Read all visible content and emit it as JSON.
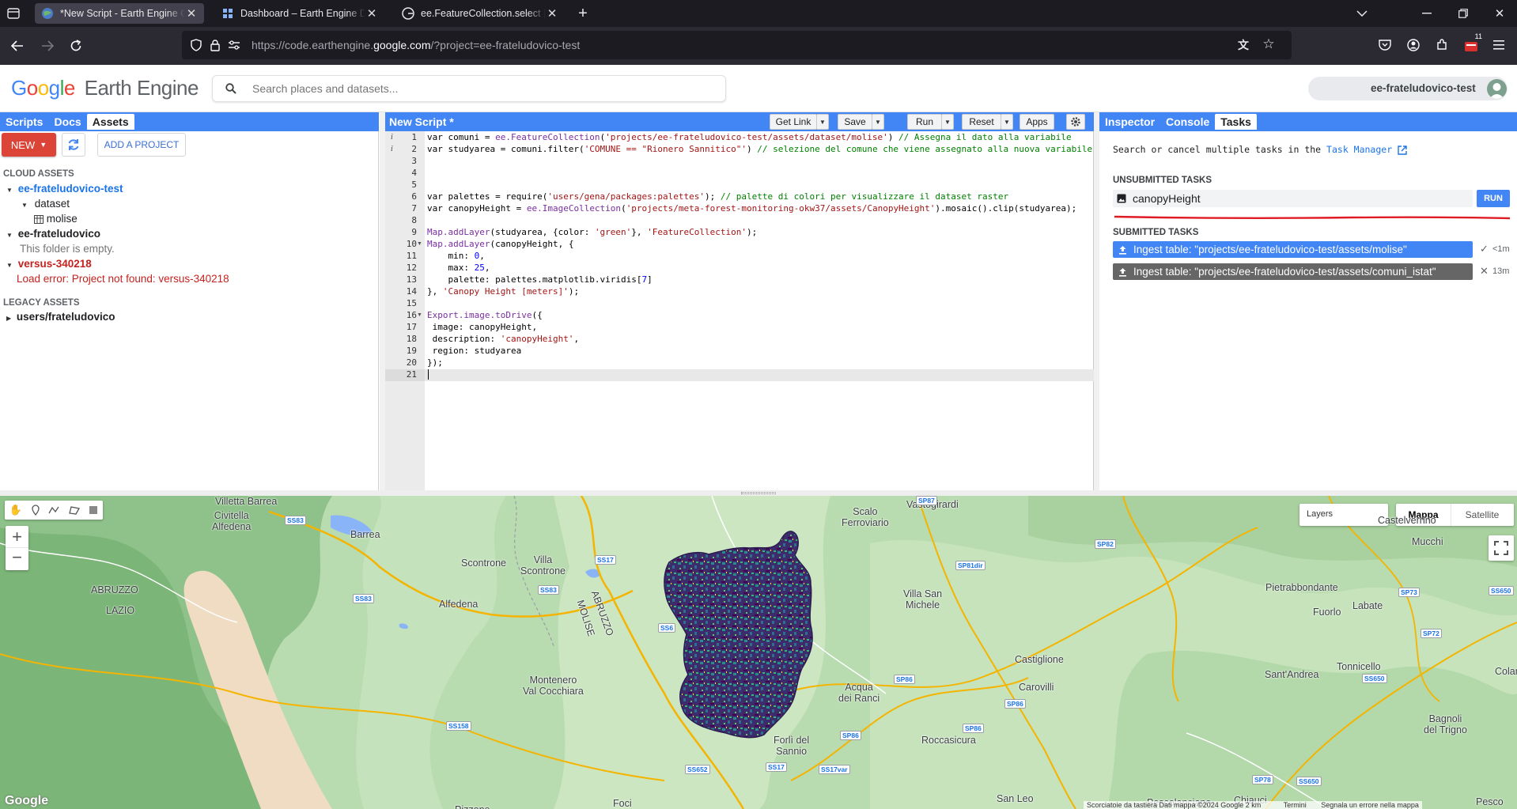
{
  "browser": {
    "tabs": [
      {
        "title": "*New Script - Earth Engine Code Editor"
      },
      {
        "title": "Dashboard – Earth Engine Default"
      },
      {
        "title": "ee.FeatureCollection.select | Google"
      }
    ],
    "url_prefix": "https://code.earthengine.",
    "url_domain": "google.com",
    "url_suffix": "/?project=ee-frateludovico-test",
    "extension_badge": "11"
  },
  "header": {
    "logo_letters": [
      "G",
      "o",
      "o",
      "g",
      "l",
      "e"
    ],
    "logo_colors": [
      "#4285f4",
      "#ea4335",
      "#fbbc05",
      "#4285f4",
      "#34a853",
      "#ea4335"
    ],
    "product": "Earth Engine",
    "search_placeholder": "Search places and datasets...",
    "account": "ee-frateludovico-test"
  },
  "left_panel": {
    "tabs": [
      "Scripts",
      "Docs",
      "Assets"
    ],
    "new_label": "NEW",
    "add_project": "ADD A PROJECT",
    "cloud_assets": "CLOUD ASSETS",
    "legacy_assets": "LEGACY ASSETS",
    "tree": {
      "p1": "ee-frateludovico-test",
      "folder": "dataset",
      "table": "molise",
      "p2": "ee-frateludovico",
      "empty": "This folder is empty.",
      "p3": "versus-340218",
      "error": "Load error: Project not found: versus-340218",
      "legacy": "users/frateludovico"
    }
  },
  "editor": {
    "title": "New Script *",
    "buttons": {
      "get_link": "Get Link",
      "save": "Save",
      "run": "Run",
      "reset": "Reset",
      "apps": "Apps"
    },
    "line_numbers": [
      "1",
      "2",
      "3",
      "4",
      "5",
      "6",
      "7",
      "8",
      "9",
      "10",
      "11",
      "12",
      "13",
      "14",
      "15",
      "16",
      "17",
      "18",
      "19",
      "20",
      "21"
    ],
    "code": {
      "l1a": "var comuni = ",
      "l1b": "ee.FeatureCollection",
      "l1c": "(",
      "l1d": "'projects/ee-frateludovico-test/assets/dataset/molise'",
      "l1e": ") ",
      "l1f": "// Assegna il dato alla variabile",
      "l2a": "var studyarea = comuni.filter(",
      "l2b": "'COMUNE == \"Rionero Sannitico\"'",
      "l2c": ") ",
      "l2d": "// selezione del comune che viene assegnato alla nuova variabile",
      "l6a": "var palettes = require(",
      "l6b": "'users/gena/packages:palettes'",
      "l6c": "); ",
      "l6d": "// palette di colori per visualizzare il dataset raster",
      "l7a": "var canopyHeight = ",
      "l7b": "ee.ImageCollection",
      "l7c": "(",
      "l7d": "'projects/meta-forest-monitoring-okw37/assets/CanopyHeight'",
      "l7e": ").mosaic().clip(studyarea);",
      "l9a": "Map.addLayer",
      "l9b": "(studyarea, {color: ",
      "l9c": "'green'",
      "l9d": "}, ",
      "l9e": "'FeatureCollection'",
      "l9f": ");",
      "l10a": "Map.addLayer",
      "l10b": "(canopyHeight, {",
      "l11a": "    min: ",
      "l11b": "0",
      "l11c": ",",
      "l12a": "    max: ",
      "l12b": "25",
      "l12c": ",",
      "l13a": "    palette: palettes.matplotlib.viridis[",
      "l13b": "7",
      "l13c": "]",
      "l14a": "}, ",
      "l14b": "'Canopy Height [meters]'",
      "l14c": ");",
      "l16a": "Export.image.toDrive",
      "l16b": "({",
      "l17": " image: canopyHeight,",
      "l18a": " description: ",
      "l18b": "'canopyHeight'",
      "l18c": ",",
      "l19": " region: studyarea",
      "l20": "});"
    }
  },
  "right_panel": {
    "tabs": [
      "Inspector",
      "Console",
      "Tasks"
    ],
    "intro": "Search or cancel multiple tasks in the",
    "task_manager": "Task Manager",
    "unsubmitted_header": "UNSUBMITTED TASKS",
    "unsubmitted_task": "canopyHeight",
    "run_label": "RUN",
    "submitted_header": "SUBMITTED TASKS",
    "submitted": [
      {
        "label": "Ingest table: \"projects/ee-frateludovico-test/assets/molise\"",
        "status": "✓",
        "time": "<1m",
        "color": "#4285f4"
      },
      {
        "label": "Ingest table: \"projects/ee-frateludovico-test/assets/comuni_istat\"",
        "status": "✕",
        "time": "13m",
        "color": "#666666"
      }
    ]
  },
  "map": {
    "layers": "Layers",
    "map_type": "Mappa",
    "satellite": "Satellite",
    "places": {
      "villetta_barrea": "Villetta Barrea",
      "civitella": "Civitella\nAlfedena",
      "barrea": "Barrea",
      "villa_scontrone": "Villa\nScontrone",
      "scontrone": "Scontrone",
      "alfedena": "Alfedena",
      "abruzzo_lazio": "ABRUZZO",
      "lazio": "LAZIO",
      "abruzzo2": "ABRUZZO",
      "molise": "MOLISE",
      "montenero": "Montenero\nVal Cocchiara",
      "scalo": "Scalo\nFerroviario",
      "vastogirardi": "Vastogirardi",
      "villa_san_michele": "Villa San\nMichele",
      "acqua_ranci": "Acqua\ndei Ranci",
      "carovilli": "Carovilli",
      "castiglione": "Castiglione",
      "roccasicura": "Roccasicura",
      "forli": "Forlì del\nSannio",
      "pietrabbondante": "Pietrabbondante",
      "fuorlo": "Fuorlo",
      "labate": "Labate",
      "mucchi": "Mucchi",
      "castel": "Castelverrino",
      "santandrea": "Sant'Andrea",
      "tonnicello": "Tonnicello",
      "bagnoli": "Bagnoli\ndel Trigno",
      "colar": "Colar",
      "san_leo": "San Leo",
      "foci": "Foci",
      "pizzone": "Pizzone",
      "chiauci": "Chiauci",
      "pescolanciano": "Pescolanciano",
      "pesco": "Pesco"
    },
    "roads": {
      "ss83a": "SS83",
      "ss83b": "SS83",
      "ss83c": "SS83",
      "ss17a": "SS17",
      "ss17b": "SS17",
      "ss17var": "SS17var",
      "ss652": "SS652",
      "ss158": "SS158",
      "sp86a": "SP86",
      "sp86b": "SP86",
      "sp86c": "SP86",
      "sp86d": "SP86",
      "sp87": "SP87",
      "sp81dir": "SP81dir",
      "sp82": "SP82",
      "sp73": "SP73",
      "sp72": "SP72",
      "ss650a": "SS650",
      "ss650b": "SS650",
      "ss650c": "SS650",
      "sp78": "SP78",
      "ss6": "SS6"
    },
    "attribution": "Scorciatoie da tastiera   Dati mappa ©2024 Google   2 km",
    "terms": "Termini",
    "report": "Segnala un errore nella mappa",
    "google": "Google"
  }
}
